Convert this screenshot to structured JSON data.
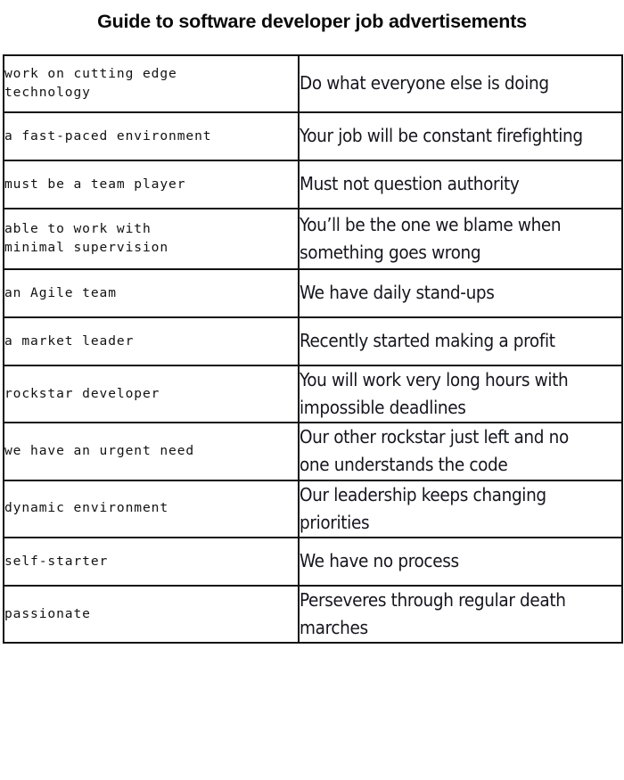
{
  "document": {
    "title": "Guide to software developer job advertisements",
    "type": "two-column comparison table"
  },
  "table": {
    "columns": [
      {
        "key": "phrase",
        "role": "job-ad-phrase"
      },
      {
        "key": "meaning",
        "role": "real-meaning"
      }
    ],
    "rows": [
      {
        "phrase": "work on cutting edge\ntechnology",
        "meaning": "Do what everyone else is doing",
        "phrase_lines": 2,
        "meaning_lines": 1
      },
      {
        "phrase": "a fast-paced environment",
        "meaning": "Your job will be constant firefighting",
        "phrase_lines": 1,
        "meaning_lines": 1
      },
      {
        "phrase": "must be a team player",
        "meaning": "Must not question authority",
        "phrase_lines": 1,
        "meaning_lines": 1
      },
      {
        "phrase": "able to work with\nminimal supervision",
        "meaning": "You’ll be the one we blame when\nsomething goes wrong",
        "phrase_lines": 2,
        "meaning_lines": 2
      },
      {
        "phrase": "an Agile team",
        "meaning": "We have daily stand-ups",
        "phrase_lines": 1,
        "meaning_lines": 1
      },
      {
        "phrase": "a market leader",
        "meaning": "Recently started making a profit",
        "phrase_lines": 1,
        "meaning_lines": 1
      },
      {
        "phrase": "rockstar developer",
        "meaning": "You will work very long hours with\nimpossible deadlines",
        "phrase_lines": 1,
        "meaning_lines": 2
      },
      {
        "phrase": "we have an urgent need",
        "meaning": "Our other rockstar just left and no\none understands the code",
        "phrase_lines": 1,
        "meaning_lines": 2
      },
      {
        "phrase": "dynamic environment",
        "meaning": "Our leadership keeps changing\npriorities",
        "phrase_lines": 1,
        "meaning_lines": 2
      },
      {
        "phrase": "self-starter",
        "meaning": "We have no process",
        "phrase_lines": 1,
        "meaning_lines": 1
      },
      {
        "phrase": "passionate",
        "meaning": "Perseveres through regular death\nmarches",
        "phrase_lines": 1,
        "meaning_lines": 2
      }
    ]
  },
  "colors": {
    "background": "#ffffff",
    "border": "#111111",
    "title_text": "#0a0a0a",
    "phrase_text": "#121212",
    "meaning_text": "#15151e"
  }
}
